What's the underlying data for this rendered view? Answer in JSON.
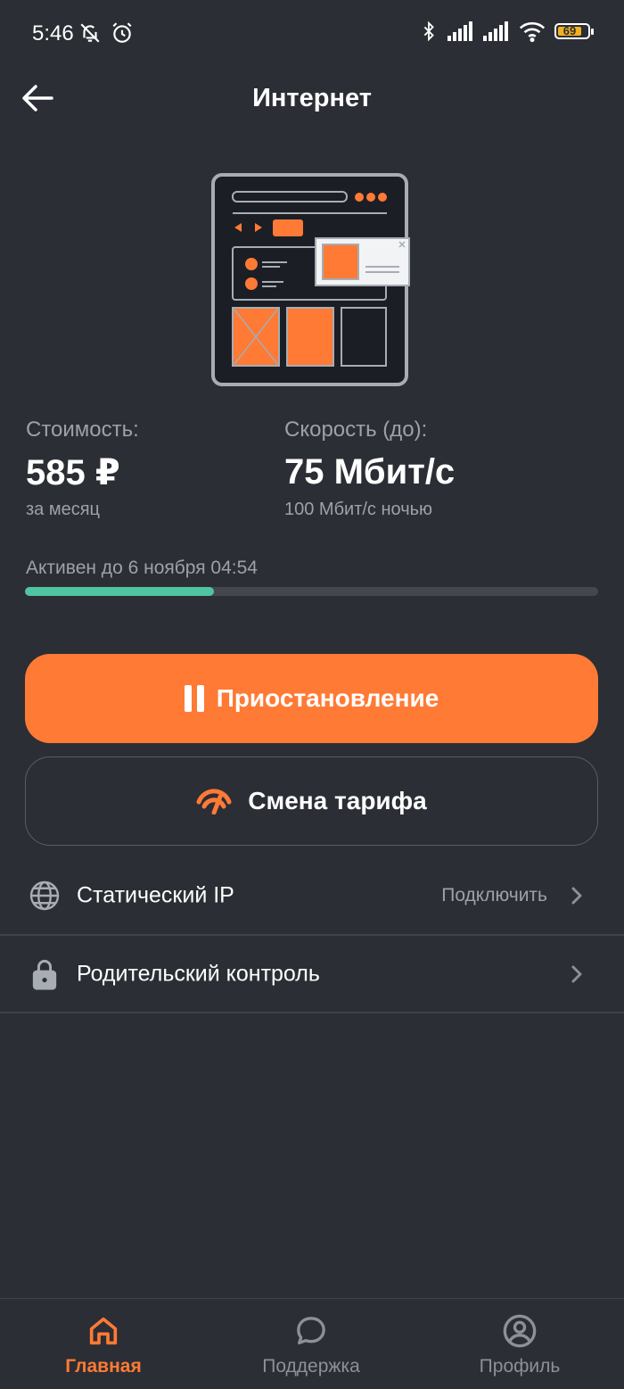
{
  "status_bar": {
    "time": "5:46",
    "battery": "69"
  },
  "header": {
    "title": "Интернет"
  },
  "cost": {
    "label": "Стоимость:",
    "value": "585 ₽",
    "note": "за месяц"
  },
  "speed": {
    "label": "Скорость (до):",
    "value": "75 Мбит/с",
    "note": "100 Мбит/с ночью"
  },
  "active": {
    "label": "Активен до 6 ноября 04:54",
    "progress": 0.33
  },
  "actions": {
    "pause_label": "Приостановление",
    "change_tariff_label": "Смена тарифа"
  },
  "options": [
    {
      "label": "Статический IP",
      "value": "Подключить",
      "icon": "globe-icon"
    },
    {
      "label": "Родительский контроль",
      "value": "",
      "icon": "lock-icon"
    }
  ],
  "nav": [
    {
      "label": "Главная",
      "icon": "home-icon",
      "active": true
    },
    {
      "label": "Поддержка",
      "icon": "chat-bubble-icon",
      "active": false
    },
    {
      "label": "Профиль",
      "icon": "profile-icon",
      "active": false
    }
  ],
  "colors": {
    "accent": "#ff7a35",
    "background": "#2b2e34",
    "progress": "#4fc4a0"
  }
}
